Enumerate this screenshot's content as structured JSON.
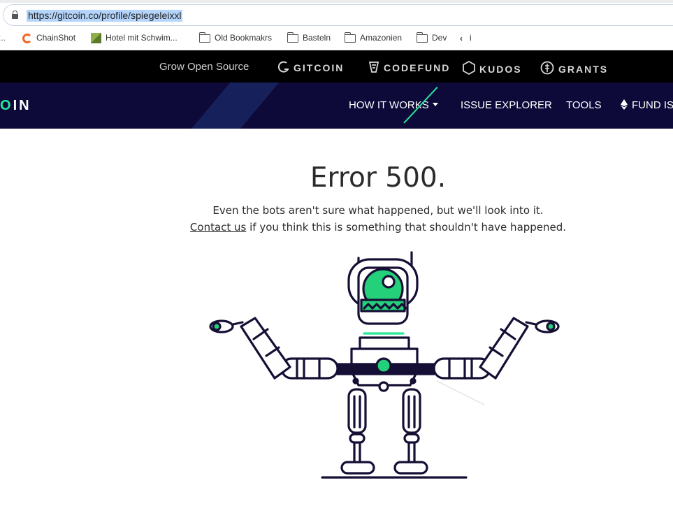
{
  "browser": {
    "url": "https://gitcoin.co/profile/spiegeleixxl",
    "bookmarks": [
      {
        "label": "ChainShot",
        "icon": "chainshot-icon"
      },
      {
        "label": "Hotel mit Schwim...",
        "icon": "hotel-icon"
      },
      {
        "label": "Old Bookmakrs",
        "icon": "folder-icon"
      },
      {
        "label": "Basteln",
        "icon": "folder-icon"
      },
      {
        "label": "Amazonien",
        "icon": "folder-icon"
      },
      {
        "label": "Dev",
        "icon": "folder-icon"
      },
      {
        "label": "i",
        "icon": "k-icon"
      }
    ]
  },
  "topbar": {
    "tagline": "Grow Open Source",
    "brands": [
      "GITCOIN",
      "CODEFUND",
      "KUDOS",
      "GRANTS"
    ]
  },
  "navbar": {
    "logo_partial_o": "O",
    "logo_partial_rest": "IN",
    "items": [
      "HOW IT WORKS",
      "ISSUE EXPLORER",
      "TOOLS",
      "FUND IS"
    ]
  },
  "error": {
    "title": "Error 500.",
    "line1": "Even the bots aren't sure what happened, but we'll look into it.",
    "contact_link": "Contact us",
    "line2_rest": " if you think this is something that shouldn't have happened."
  },
  "colors": {
    "accent": "#25e899",
    "navy": "#0d0a3a",
    "robot_outline": "#160f35"
  }
}
